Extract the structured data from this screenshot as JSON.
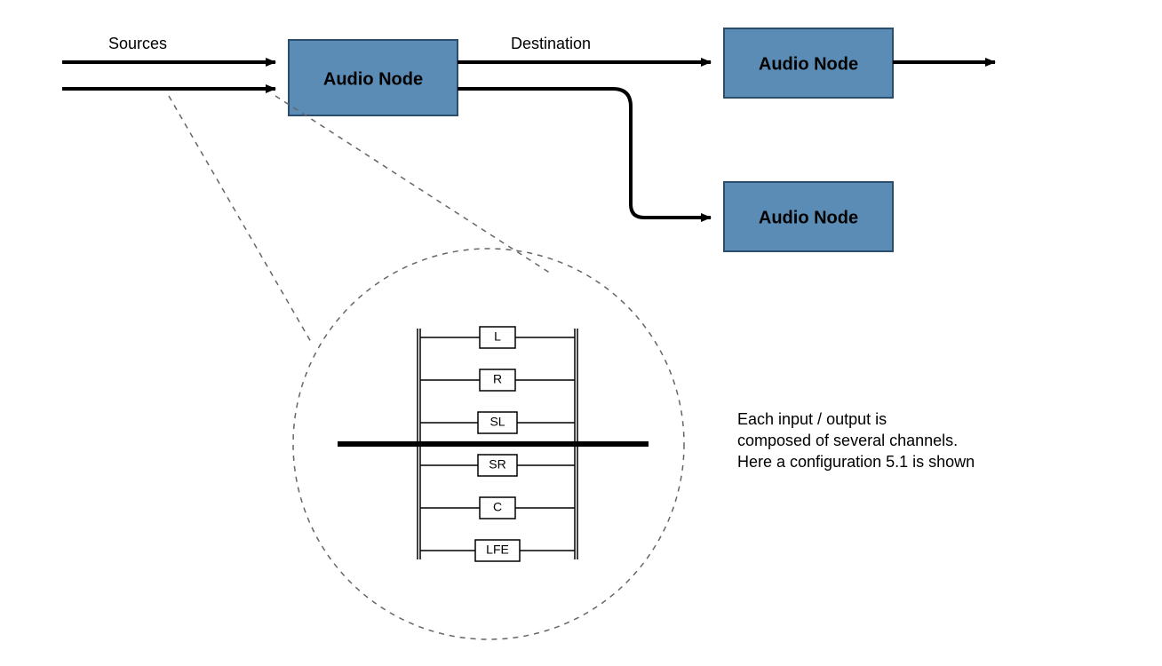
{
  "labels": {
    "sources": "Sources",
    "destination": "Destination"
  },
  "nodes": {
    "main": "Audio Node",
    "top": "Audio Node",
    "bottom": "Audio Node"
  },
  "channels": [
    "L",
    "R",
    "SL",
    "SR",
    "C",
    "LFE"
  ],
  "description": {
    "line1": "Each input / output is",
    "line2": "composed of several channels.",
    "line3": "Here a configuration 5.1 is shown"
  },
  "colors": {
    "node_fill": "#5b8cb5",
    "node_stroke": "#2a4d6b"
  }
}
